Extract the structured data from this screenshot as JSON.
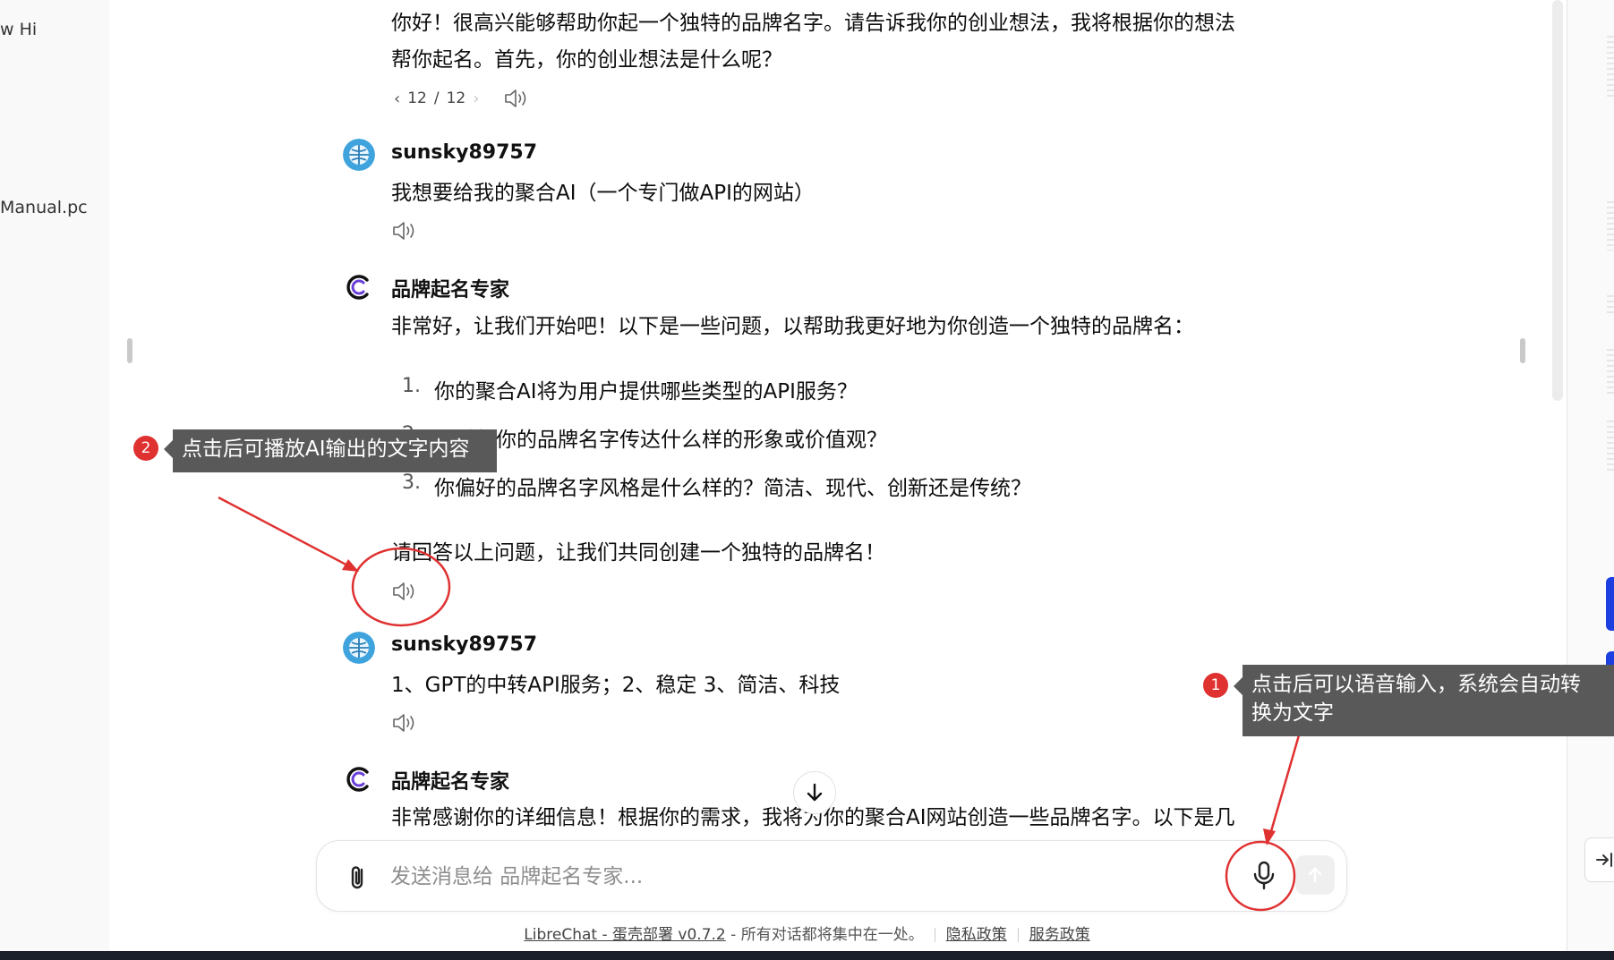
{
  "sidebar_left": {
    "items": [
      {
        "text": "w Hi"
      },
      {
        "text": "Manual.pc"
      }
    ]
  },
  "conversation": {
    "intro_message": {
      "line1": "你好！很高兴能够帮助你起一个独特的品牌名字。请告诉我你的创业想法，我将根据你的想法",
      "line2": "帮你起名。首先，你的创业想法是什么呢？",
      "pager": {
        "current": "12",
        "separator": "/",
        "total": "12"
      }
    },
    "messages": [
      {
        "author": "sunsky89757",
        "text": "我想要给我的聚合AI（一个专门做API的网站）"
      },
      {
        "author": "品牌起名专家",
        "intro": "非常好，让我们开始吧！以下是一些问题，以帮助我更好地为你创造一个独特的品牌名：",
        "list": [
          {
            "num": "1.",
            "text": "你的聚合AI将为用户提供哪些类型的API服务？"
          },
          {
            "num": "2.",
            "text": "你希望你的品牌名字传达什么样的形象或价值观？"
          },
          {
            "num": "3.",
            "text": "你偏好的品牌名字风格是什么样的？简洁、现代、创新还是传统？"
          }
        ],
        "outro": "请回答以上问题，让我们共同创建一个独特的品牌名！"
      },
      {
        "author": "sunsky89757",
        "text": "1、GPT的中转API服务；2、稳定 3、简洁、科技"
      },
      {
        "author": "品牌起名专家",
        "text": "非常感谢你的详细信息！根据你的需求，我将为你的聚合AI网站创造一些品牌名字。以下是几"
      }
    ]
  },
  "annotations": [
    {
      "number": "1",
      "text_line1": "点击后可以语音输入，系统会自动转",
      "text_line2": "换为文字"
    },
    {
      "number": "2",
      "text": "点击后可播放AI输出的文字内容"
    }
  ],
  "composer": {
    "placeholder": "发送消息给 品牌起名专家..."
  },
  "footer": {
    "brand_link": "LibreChat - 蛋壳部署 v0.7.2",
    "tagline": " - 所有对话都将集中在一处。",
    "privacy": "隐私政策",
    "terms": "服务政策"
  },
  "icons": {
    "attach": "paperclip-icon",
    "mic": "microphone-icon",
    "send": "arrow-up-icon",
    "speaker": "speaker-icon",
    "scroll_down": "arrow-down-icon",
    "collapse": "arrow-right-to-bar-icon"
  },
  "colors": {
    "annotation_red": "#e03131",
    "callout_bg": "#595959",
    "blue_tab": "#1d3fe0"
  }
}
